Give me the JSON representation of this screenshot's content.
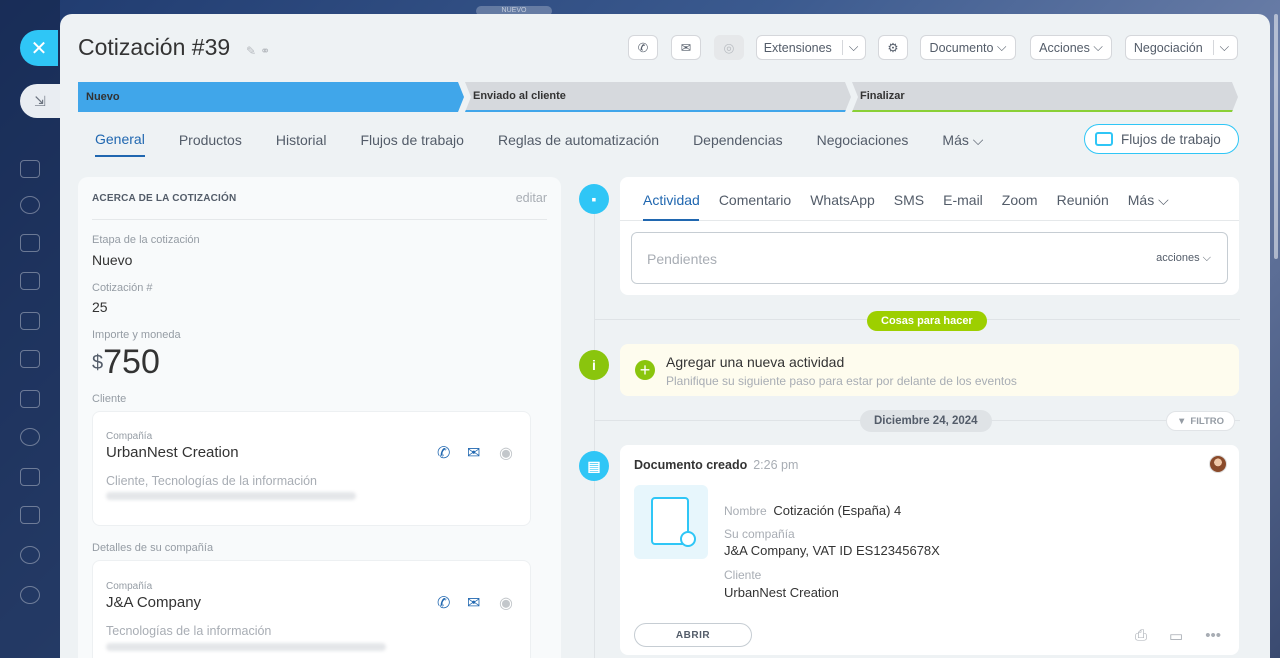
{
  "window": {
    "top_pill": "NUEVO"
  },
  "header": {
    "title": "Cotización #39",
    "toolbar": {
      "extensions": "Extensiones",
      "document": "Documento",
      "actions": "Acciones",
      "deal": "Negociación"
    }
  },
  "stages": [
    {
      "label": "Nuevo",
      "color": "#40a6ea"
    },
    {
      "label": "Enviado al cliente",
      "color": "#d6d9dd"
    },
    {
      "label": "Finalizar",
      "color": "#d6d9dd"
    }
  ],
  "tabs": {
    "items": [
      "General",
      "Productos",
      "Historial",
      "Flujos de trabajo",
      "Reglas de automatización",
      "Dependencias",
      "Negociaciones",
      "Más"
    ],
    "active": "General",
    "flows_button": "Flujos de trabajo"
  },
  "about": {
    "heading": "ACERCA DE LA COTIZACIÓN",
    "edit": "editar",
    "stage_label": "Etapa de la cotización",
    "stage_value": "Nuevo",
    "number_label": "Cotización #",
    "number_value": "25",
    "amount_label": "Importe y moneda",
    "amount_currency": "$",
    "amount_value": "750",
    "client_label": "Cliente",
    "client": {
      "company_label": "Compañía",
      "name": "UrbanNest Creation",
      "sub": "Cliente, Tecnologías de la información"
    },
    "my_company_label": "Detalles de su compañía",
    "my_company": {
      "company_label": "Compañía",
      "name": "J&A Company",
      "sub": "Tecnologías de la información"
    }
  },
  "activity": {
    "tabs": [
      "Actividad",
      "Comentario",
      "WhatsApp",
      "SMS",
      "E-mail",
      "Zoom",
      "Reunión",
      "Más"
    ],
    "pending_placeholder": "Pendientes",
    "pending_actions": "acciones",
    "todo_badge": "Cosas para hacer",
    "todo_title": "Agregar una nueva actividad",
    "todo_sub": "Planifique su siguiente paso para estar por delante de los eventos",
    "date_badge": "Diciembre 24, 2024",
    "filter": "FILTRO"
  },
  "document": {
    "title": "Documento creado",
    "time": "2:26 pm",
    "name_label": "Nombre",
    "name_value": "Cotización (España) 4",
    "company_label": "Su compañía",
    "company_value": "J&A Company, VAT ID ES12345678X",
    "client_label": "Cliente",
    "client_value": "UrbanNest Creation",
    "open_button": "ABRIR"
  }
}
